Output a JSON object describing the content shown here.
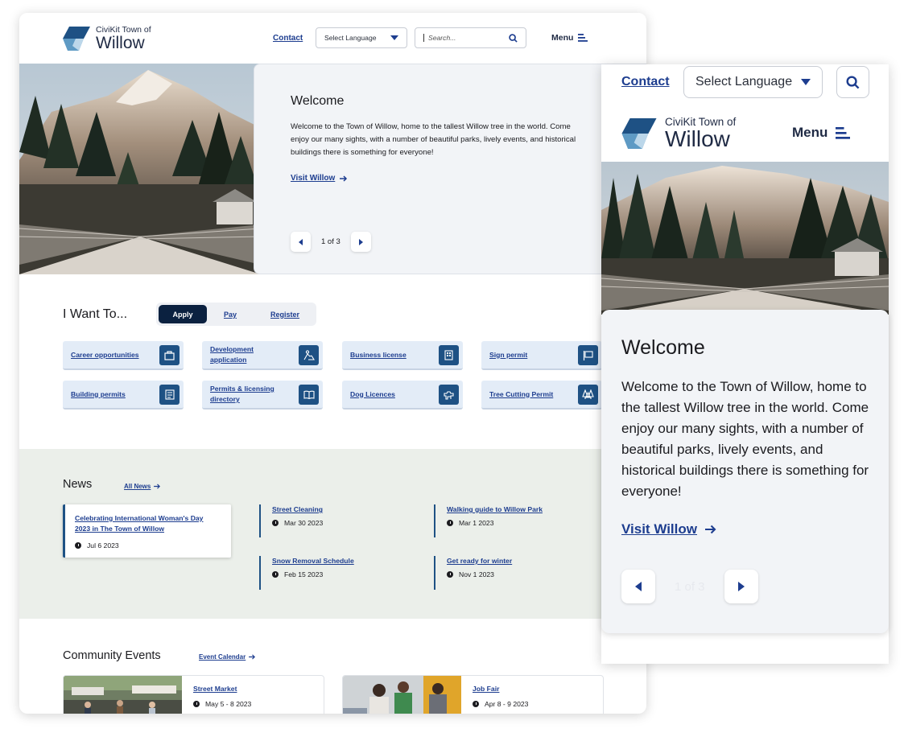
{
  "brand": {
    "small": "CiviKit Town of",
    "name": "Willow",
    "colors": {
      "navy": "#0b2140",
      "blue": "#1d3d8f",
      "tile_bg": "#e3ecf7",
      "icon_bg": "#1e5184",
      "news_bg": "#ebefea"
    }
  },
  "header": {
    "contact": "Contact",
    "language": "Select Language",
    "search_placeholder": "Search...",
    "menu": "Menu"
  },
  "hero": {
    "title": "Welcome",
    "body": "Welcome to the Town of Willow, home to the tallest Willow tree in the world. Come enjoy our many sights, with a number of beautiful parks, lively events, and historical buildings there is something for everyone!",
    "link": "Visit Willow",
    "pager": "1 of 3"
  },
  "iwant": {
    "title": "I Want To...",
    "tabs": [
      "Apply",
      "Pay",
      "Register"
    ],
    "tiles": [
      {
        "label": "Career opportunities",
        "icon": "briefcase-icon"
      },
      {
        "label": "Development application",
        "icon": "construction-icon"
      },
      {
        "label": "Business license",
        "icon": "building-icon"
      },
      {
        "label": "Sign permit",
        "icon": "sign-icon"
      },
      {
        "label": "Building permits",
        "icon": "permit-icon"
      },
      {
        "label": "Permits & licensing directory",
        "icon": "book-icon"
      },
      {
        "label": "Dog Licences",
        "icon": "dog-icon"
      },
      {
        "label": "Tree Cutting Permit",
        "icon": "trees-icon"
      }
    ]
  },
  "news": {
    "title": "News",
    "all": "All News",
    "featured": {
      "title": "Celebrating International Woman's Day 2023 in The Town of Willow",
      "date": "Jul 6 2023"
    },
    "items": [
      {
        "title": "Street Cleaning",
        "date": "Mar 30 2023"
      },
      {
        "title": "Walking guide to  Willow Park",
        "date": "Mar 1 2023"
      },
      {
        "title": "Snow Removal Schedule",
        "date": "Feb 15 2023"
      },
      {
        "title": "Get ready for winter",
        "date": "Nov 1 2023"
      }
    ]
  },
  "events": {
    "title": "Community Events",
    "calendar": "Event Calendar",
    "items": [
      {
        "title": "Street Market",
        "date": "May 5 - 8 2023"
      },
      {
        "title": "Job Fair",
        "date": "Apr 8 - 9 2023"
      }
    ]
  }
}
